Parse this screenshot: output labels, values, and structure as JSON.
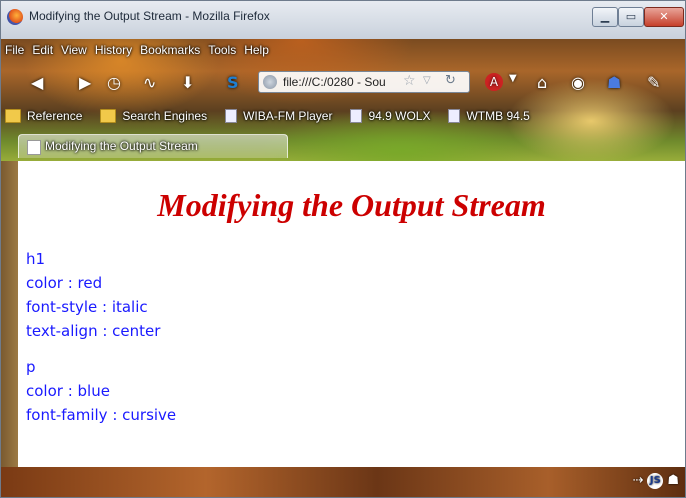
{
  "window": {
    "title": "Modifying the Output Stream - Mozilla Firefox",
    "controls": {
      "minimize": "▁",
      "maximize": "▭",
      "close": "✕"
    }
  },
  "menu": [
    "File",
    "Edit",
    "View",
    "History",
    "Bookmarks",
    "Tools",
    "Help"
  ],
  "navbar": {
    "url": "file:///C:/0280 - Sou",
    "icons": [
      "back-icon",
      "forward-icon",
      "history-clock-icon",
      "rss-icon",
      "download-icon",
      "skype-icon",
      "adblock-icon",
      "home-icon",
      "eye-icon",
      "ghost-icon",
      "tools-icon"
    ]
  },
  "bookmarks": [
    {
      "label": "Reference",
      "type": "folder"
    },
    {
      "label": "Search Engines",
      "type": "folder"
    },
    {
      "label": "WIBA-FM Player",
      "type": "page"
    },
    {
      "label": "94.9 WOLX",
      "type": "page"
    },
    {
      "label": "WTMB 94.5",
      "type": "page"
    }
  ],
  "tab": {
    "label": "Modifying the Output Stream"
  },
  "page": {
    "heading": "Modifying the Output Stream",
    "h1_rules": {
      "selector": "h1",
      "lines": [
        "color : red",
        "font-style : italic",
        "text-align : center"
      ]
    },
    "p_rules": {
      "selector": "p",
      "lines": [
        "color : blue",
        "font-family : cursive"
      ]
    }
  },
  "colors": {
    "heading": "#cc0000",
    "rules_text": "#1a1aff"
  }
}
